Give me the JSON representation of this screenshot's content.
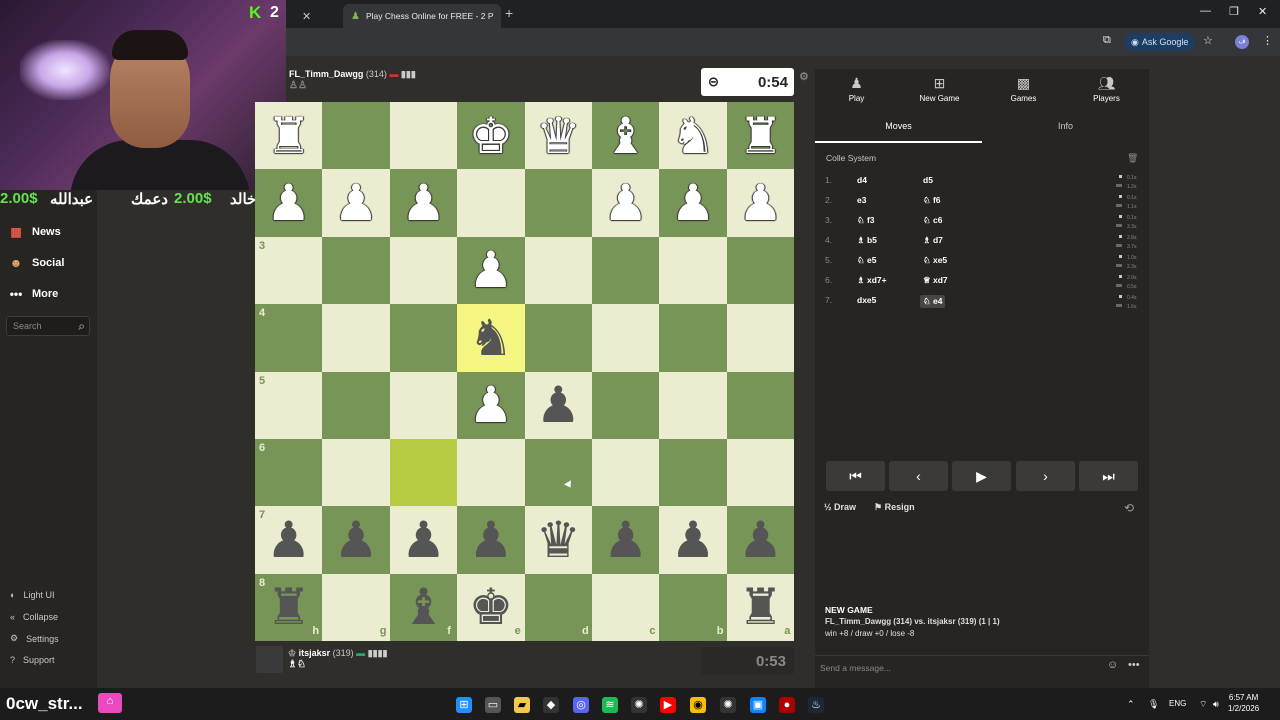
{
  "browser": {
    "active_tab_title": "Play Chess Online for FREE - 2 P",
    "ask_google": "Ask Google",
    "profile_initial": "ف"
  },
  "stream": {
    "kick_count": "2",
    "ticker": {
      "amount_left": "2.00$",
      "name_left": "عبدالله",
      "amount_mid": "2.00$",
      "text_mid": "دعمك",
      "name_right": "ابو خالد:"
    },
    "channel_tag": "0cw_str..."
  },
  "sidebar": {
    "items": [
      {
        "label": "News",
        "icon": "news-icon"
      },
      {
        "label": "Social",
        "icon": "social-icon"
      },
      {
        "label": "More",
        "icon": "more-icon"
      }
    ],
    "search_placeholder": "Search",
    "bottom": [
      {
        "label": "Light UI",
        "icon": "light-ui-icon"
      },
      {
        "label": "Collapse",
        "icon": "collapse-icon"
      },
      {
        "label": "Settings",
        "icon": "gear-icon"
      },
      {
        "label": "Support",
        "icon": "support-icon"
      }
    ]
  },
  "game": {
    "top_player": {
      "name": "FL_Timm_Dawgg",
      "rating": "(314)",
      "clock": "0:54"
    },
    "bottom_player": {
      "name": "itsjaksr",
      "rating": "(319)",
      "clock": "0:53"
    },
    "rank_labels": [
      "3",
      "4",
      "5",
      "6",
      "7",
      "8"
    ],
    "file_labels": [
      "h",
      "g",
      "f",
      "e",
      "d",
      "c",
      "b",
      "a"
    ],
    "pieces": [
      {
        "row": 0,
        "col": 0,
        "glyph": "♜",
        "color": "w"
      },
      {
        "row": 0,
        "col": 3,
        "glyph": "♚",
        "color": "w"
      },
      {
        "row": 0,
        "col": 4,
        "glyph": "♛",
        "color": "w"
      },
      {
        "row": 0,
        "col": 5,
        "glyph": "♝",
        "color": "w"
      },
      {
        "row": 0,
        "col": 6,
        "glyph": "♞",
        "color": "w"
      },
      {
        "row": 0,
        "col": 7,
        "glyph": "♜",
        "color": "w"
      },
      {
        "row": 1,
        "col": 0,
        "glyph": "♟",
        "color": "w"
      },
      {
        "row": 1,
        "col": 1,
        "glyph": "♟",
        "color": "w"
      },
      {
        "row": 1,
        "col": 2,
        "glyph": "♟",
        "color": "w"
      },
      {
        "row": 1,
        "col": 5,
        "glyph": "♟",
        "color": "w"
      },
      {
        "row": 1,
        "col": 6,
        "glyph": "♟",
        "color": "w"
      },
      {
        "row": 1,
        "col": 7,
        "glyph": "♟",
        "color": "w"
      },
      {
        "row": 2,
        "col": 3,
        "glyph": "♟",
        "color": "w"
      },
      {
        "row": 3,
        "col": 3,
        "glyph": "♞",
        "color": "b"
      },
      {
        "row": 4,
        "col": 3,
        "glyph": "♟",
        "color": "w"
      },
      {
        "row": 4,
        "col": 4,
        "glyph": "♟",
        "color": "b"
      },
      {
        "row": 6,
        "col": 0,
        "glyph": "♟",
        "color": "b"
      },
      {
        "row": 6,
        "col": 1,
        "glyph": "♟",
        "color": "b"
      },
      {
        "row": 6,
        "col": 2,
        "glyph": "♟",
        "color": "b"
      },
      {
        "row": 6,
        "col": 3,
        "glyph": "♟",
        "color": "b"
      },
      {
        "row": 6,
        "col": 4,
        "glyph": "♛",
        "color": "b"
      },
      {
        "row": 6,
        "col": 5,
        "glyph": "♟",
        "color": "b"
      },
      {
        "row": 6,
        "col": 6,
        "glyph": "♟",
        "color": "b"
      },
      {
        "row": 6,
        "col": 7,
        "glyph": "♟",
        "color": "b"
      },
      {
        "row": 7,
        "col": 0,
        "glyph": "♜",
        "color": "b"
      },
      {
        "row": 7,
        "col": 2,
        "glyph": "♝",
        "color": "b"
      },
      {
        "row": 7,
        "col": 3,
        "glyph": "♚",
        "color": "b"
      },
      {
        "row": 7,
        "col": 7,
        "glyph": "♜",
        "color": "b"
      }
    ],
    "highlights": [
      {
        "row": 3,
        "col": 3
      },
      {
        "row": 5,
        "col": 2
      }
    ]
  },
  "panel": {
    "tabs": [
      {
        "label": "Play",
        "icon": "pawn-icon"
      },
      {
        "label": "New Game",
        "icon": "plus-icon"
      },
      {
        "label": "Games",
        "icon": "board-icon"
      },
      {
        "label": "Players",
        "icon": "players-icon"
      }
    ],
    "subtabs": [
      "Moves",
      "Info"
    ],
    "opening": "Colle System",
    "moves": [
      {
        "n": "1.",
        "w": "d4",
        "b": "d5",
        "tw": "0.1s",
        "tb": "1.2s"
      },
      {
        "n": "2.",
        "w": "e3",
        "b": "♘ f6",
        "tw": "0.1s",
        "tb": "1.1s"
      },
      {
        "n": "3.",
        "w": "♘ f3",
        "b": "♘ c6",
        "tw": "0.1s",
        "tb": "3.3s"
      },
      {
        "n": "4.",
        "w": "♗ b5",
        "b": "♗ d7",
        "tw": "2.8s",
        "tb": "3.7s"
      },
      {
        "n": "5.",
        "w": "♘ e5",
        "b": "♘ xe5",
        "tw": "1.0s",
        "tb": "2.3s"
      },
      {
        "n": "6.",
        "w": "♗ xd7+",
        "b": "♕ xd7",
        "tw": "2.0s",
        "tb": "0.5s"
      },
      {
        "n": "7.",
        "w": "dxe5",
        "b": "♘ e4",
        "tw": "0.4s",
        "tb": "1.6s"
      }
    ],
    "draw_label": "Draw",
    "draw_icon": "½",
    "resign_label": "Resign",
    "chat": {
      "title": "NEW GAME",
      "line1_players": "FL_Timm_Dawgg (314) vs. itsjaksr (319) (1 | 1)",
      "line2": "win +8 / draw +0 / lose -8"
    },
    "message_placeholder": "Send a message..."
  },
  "taskbar": {
    "lang": "ENG",
    "time": "6:57 AM",
    "date": "1/2/2026"
  }
}
